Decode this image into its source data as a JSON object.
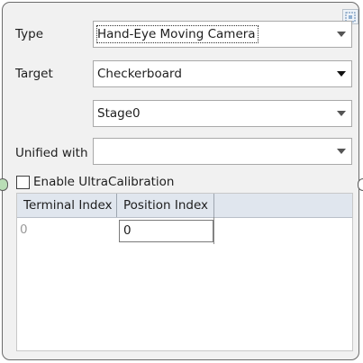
{
  "form": {
    "type_label": "Type",
    "type_value": "Hand-Eye Moving Camera",
    "target_label": "Target",
    "target_value": "Checkerboard",
    "stage_value": "Stage0",
    "unified_label": "Unified with",
    "unified_value": ""
  },
  "ultra_calibration": {
    "label": "Enable UltraCalibration",
    "checked": false
  },
  "table": {
    "columns": [
      "Terminal Index",
      "Position Index"
    ],
    "rows": [
      {
        "terminal_index": "0",
        "position_index": "0"
      }
    ]
  },
  "icons": {
    "corner_button": "select-region-icon",
    "left_connector": "input-port-icon",
    "right_connector": "output-port-icon"
  },
  "colors": {
    "panel_background": "#f1f1f1",
    "header_background": "#e0e6ee",
    "left_connector": "#b9ddb6"
  }
}
